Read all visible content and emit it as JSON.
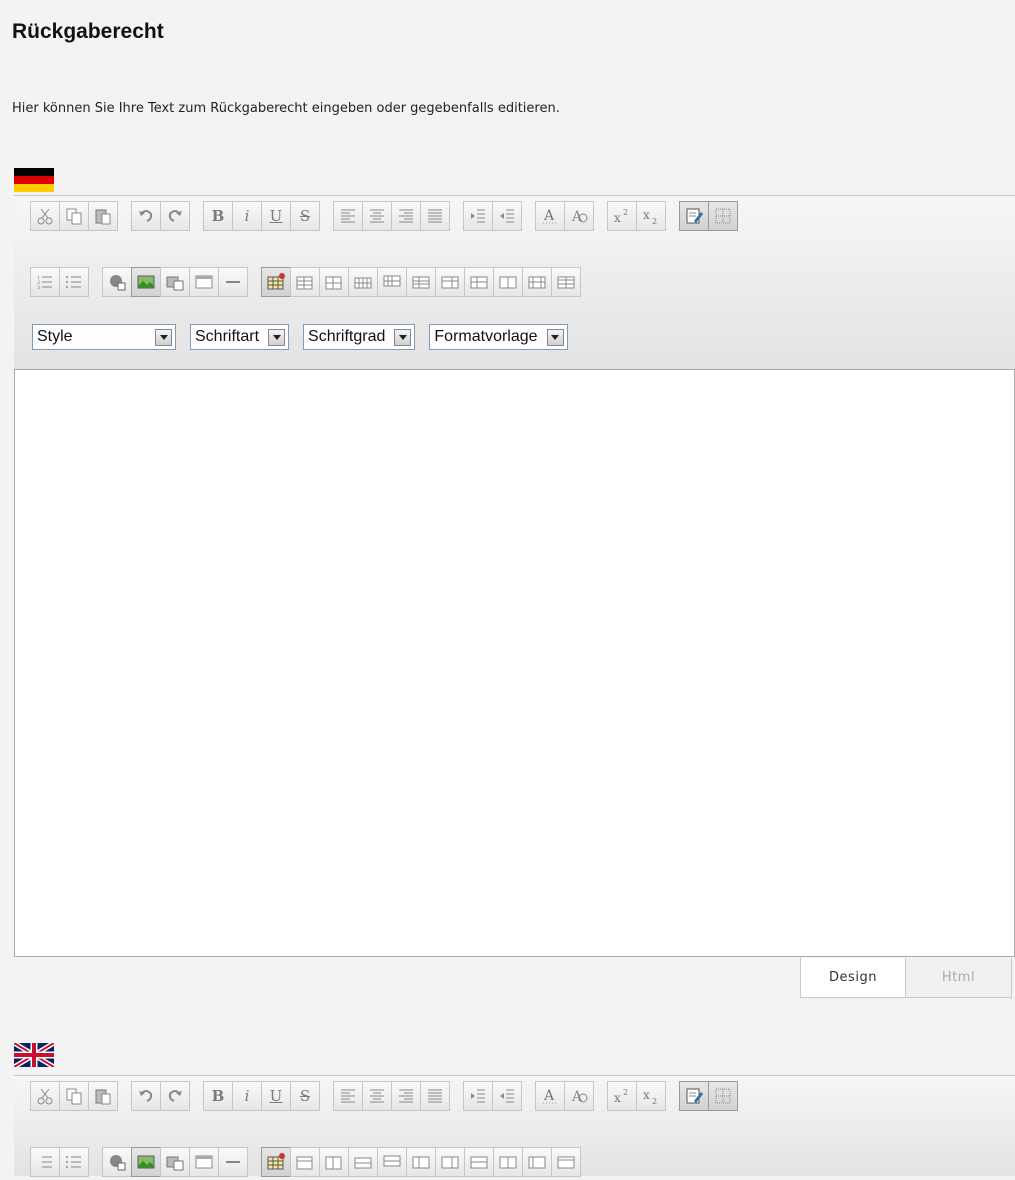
{
  "page": {
    "title": "Rückgaberecht",
    "description": "Hier können Sie Ihre Text zum Rückgaberecht eingeben oder gegebenfalls editieren."
  },
  "colors": {
    "flag_black": "#000000",
    "flag_red": "#dd0000",
    "flag_gold": "#ffce00",
    "uk_blue": "#012169",
    "uk_red": "#c8102e"
  },
  "editor_de": {
    "language_icon": "german-flag-icon",
    "dropdowns": {
      "style": "Style",
      "font": "Schriftart",
      "size": "Schriftgrad",
      "format": "Formatvorlage"
    },
    "mode_tabs": {
      "design": "Design",
      "html": "Html"
    },
    "active_mode": "Design"
  },
  "editor_en": {
    "language_icon": "uk-flag-icon"
  },
  "toolbar_buttons": {
    "bold": "B",
    "italic": "i",
    "underline": "U",
    "strike": "S"
  }
}
